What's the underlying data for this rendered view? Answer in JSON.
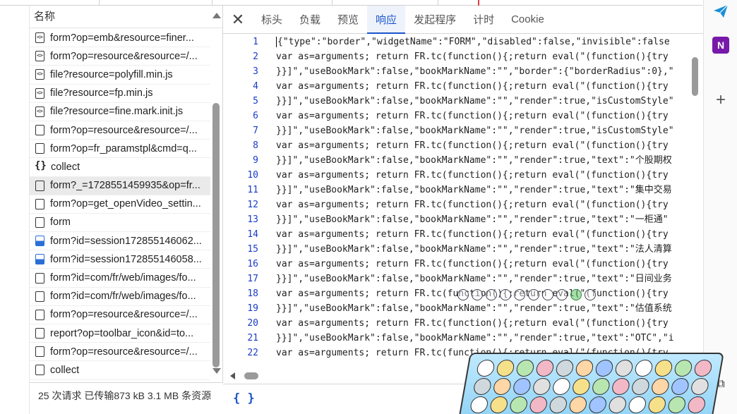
{
  "file_panel": {
    "header": "名称",
    "items": [
      {
        "name": "form?op=emb&resource=finer...",
        "icon": "script-file-icon",
        "selected": false
      },
      {
        "name": "form?op=resource&resource=/...",
        "icon": "script-file-icon",
        "selected": false
      },
      {
        "name": "file?resource=polyfill.min.js",
        "icon": "script-file-icon",
        "selected": false
      },
      {
        "name": "file?resource=fp.min.js",
        "icon": "script-file-icon",
        "selected": false
      },
      {
        "name": "file?resource=fine.mark.init.js",
        "icon": "script-file-icon",
        "selected": false
      },
      {
        "name": "form?op=resource&resource=/...",
        "icon": "document-icon",
        "selected": false
      },
      {
        "name": "form?op=fr_paramstpl&cmd=q...",
        "icon": "document-icon",
        "selected": false
      },
      {
        "name": "collect",
        "icon": "xhr-icon",
        "selected": false
      },
      {
        "name": "form?_=1728551459935&op=fr...",
        "icon": "document-icon",
        "selected": true
      },
      {
        "name": "form?op=get_openVideo_settin...",
        "icon": "document-icon",
        "selected": false
      },
      {
        "name": "form",
        "icon": "document-icon",
        "selected": false
      },
      {
        "name": "form?id=session172855146062...",
        "icon": "image-file-icon",
        "selected": false
      },
      {
        "name": "form?id=session172855146058...",
        "icon": "image-file-icon",
        "selected": false
      },
      {
        "name": "form?id=com/fr/web/images/fo...",
        "icon": "document-icon",
        "selected": false
      },
      {
        "name": "form?id=com/fr/web/images/fo...",
        "icon": "document-icon",
        "selected": false
      },
      {
        "name": "form?op=resource&resource=/...",
        "icon": "document-icon",
        "selected": false
      },
      {
        "name": "report?op=toolbar_icon&id=to...",
        "icon": "document-icon",
        "selected": false
      },
      {
        "name": "form?op=resource&resource=/...",
        "icon": "document-icon",
        "selected": false
      },
      {
        "name": "collect",
        "icon": "document-icon",
        "selected": false
      }
    ]
  },
  "status": {
    "text": "25 次请求  已传输873 kB  3.1 MB 条资源"
  },
  "tabs": [
    {
      "label": "标头",
      "active": false
    },
    {
      "label": "负载",
      "active": false
    },
    {
      "label": "预览",
      "active": false
    },
    {
      "label": "响应",
      "active": true
    },
    {
      "label": "发起程序",
      "active": false
    },
    {
      "label": "计时",
      "active": false
    },
    {
      "label": "Cookie",
      "active": false
    }
  ],
  "code_lines": [
    {
      "n": "1",
      "text": "{\"type\":\"border\",\"widgetName\":\"FORM\",\"disabled\":false,\"invisible\":false"
    },
    {
      "n": "2",
      "text": "var as=arguments; return FR.tc(function(){;return eval(\"(function(){try"
    },
    {
      "n": "3",
      "text": "}}]\",\"useBookMark\":false,\"bookMarkName\":\"\",\"border\":{\"borderRadius\":0},\""
    },
    {
      "n": "4",
      "text": "var as=arguments; return FR.tc(function(){;return eval(\"(function(){try"
    },
    {
      "n": "5",
      "text": "}}]\",\"useBookMark\":false,\"bookMarkName\":\"\",\"render\":true,\"isCustomStyle\""
    },
    {
      "n": "6",
      "text": "var as=arguments; return FR.tc(function(){;return eval(\"(function(){try"
    },
    {
      "n": "7",
      "text": "}}]\",\"useBookMark\":false,\"bookMarkName\":\"\",\"render\":true,\"isCustomStyle\""
    },
    {
      "n": "8",
      "text": "var as=arguments; return FR.tc(function(){;return eval(\"(function(){try"
    },
    {
      "n": "9",
      "text": "}}]\",\"useBookMark\":false,\"bookMarkName\":\"\",\"render\":true,\"text\":\"个股期权"
    },
    {
      "n": "10",
      "text": "var as=arguments; return FR.tc(function(){;return eval(\"(function(){try"
    },
    {
      "n": "11",
      "text": "}}]\",\"useBookMark\":false,\"bookMarkName\":\"\",\"render\":true,\"text\":\"集中交易"
    },
    {
      "n": "12",
      "text": "var as=arguments; return FR.tc(function(){;return eval(\"(function(){try"
    },
    {
      "n": "13",
      "text": "}}]\",\"useBookMark\":false,\"bookMarkName\":\"\",\"render\":true,\"text\":\"一柜通\""
    },
    {
      "n": "14",
      "text": "var as=arguments; return FR.tc(function(){;return eval(\"(function(){try"
    },
    {
      "n": "15",
      "text": "}}]\",\"useBookMark\":false,\"bookMarkName\":\"\",\"render\":true,\"text\":\"法人清算"
    },
    {
      "n": "16",
      "text": "var as=arguments; return FR.tc(function(){;return eval(\"(function(){try"
    },
    {
      "n": "17",
      "text": "}}]\",\"useBookMark\":false,\"bookMarkName\":\"\",\"render\":true,\"text\":\"日间业务"
    },
    {
      "n": "18",
      "text": "var as=arguments; return FR.tc(function(){;return eval(\"(function(){try"
    },
    {
      "n": "19",
      "text": "}}]\",\"useBookMark\":false,\"bookMarkName\":\"\",\"render\":true,\"text\":\"估值系统"
    },
    {
      "n": "20",
      "text": "var as=arguments; return FR.tc(function(){;return eval(\"(function(){try"
    },
    {
      "n": "21",
      "text": "}}]\",\"useBookMark\":false,\"bookMarkName\":\"\",\"render\":true,\"text\":\"OTC\",\"i"
    },
    {
      "n": "22",
      "text": "var as=arguments; return FR.tc(function(){;return eval(\"(function(){try"
    }
  ],
  "bottom": {
    "format_label": "{ }"
  },
  "sidebar": {
    "onenote_label": "N",
    "plus_label": "+",
    "screenshot_label": "⧉"
  },
  "colors": {
    "accent": "#1a56c9",
    "line_number": "#1a3cc9",
    "selected_row": "#eaeaea"
  }
}
